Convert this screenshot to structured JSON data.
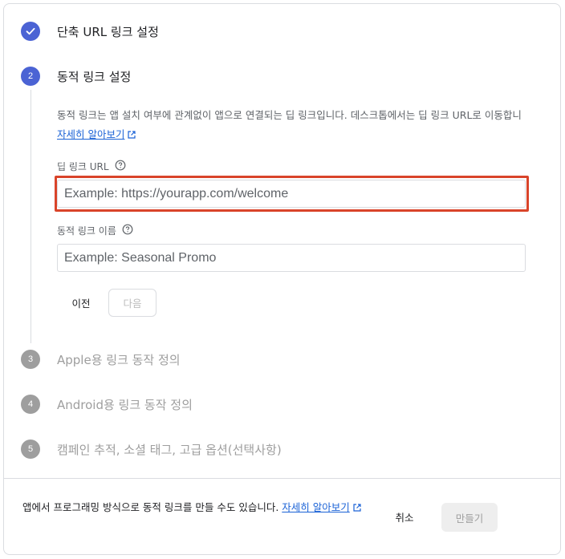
{
  "steps": [
    {
      "number": "1",
      "title": "단축 URL 링크 설정",
      "state": "done"
    },
    {
      "number": "2",
      "title": "동적 링크 설정",
      "state": "active"
    },
    {
      "number": "3",
      "title": "Apple용 링크 동작 정의",
      "state": "pending"
    },
    {
      "number": "4",
      "title": "Android용 링크 동작 정의",
      "state": "pending"
    },
    {
      "number": "5",
      "title": "캠페인 추적, 소셜 태그, 고급 옵션(선택사항)",
      "state": "pending"
    }
  ],
  "step2": {
    "description": "동적 링크는 앱 설치 여부에 관계없이 앱으로 연결되는 딥 링크입니다. 데스크톱에서는 딥 링크 URL로 이동합니",
    "learn_more": "자세히 알아보기",
    "deep_link": {
      "label": "딥 링크 URL",
      "placeholder": "Example: https://yourapp.com/welcome",
      "value": ""
    },
    "link_name": {
      "label": "동적 링크 이름",
      "placeholder": "Example: Seasonal Promo",
      "value": ""
    },
    "prev_button": "이전",
    "next_button": "다음"
  },
  "footer": {
    "text": "앱에서 프로그래밍 방식으로 동적 링크를 만들 수도 있습니다.",
    "learn_more": "자세히 알아보기",
    "cancel_button": "취소",
    "create_button": "만들기"
  },
  "colors": {
    "accent": "#4b63d4",
    "link": "#1a62d6",
    "highlight": "#d9442a",
    "pending": "#9e9e9e"
  }
}
